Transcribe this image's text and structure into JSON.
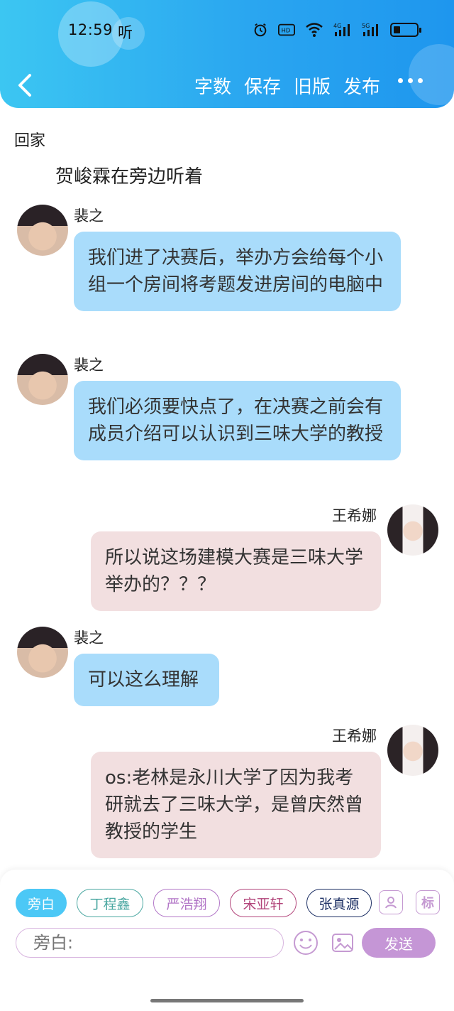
{
  "status_bar": {
    "time": "12:59",
    "extra": "听",
    "icons": [
      "alarm-icon",
      "hd-icon",
      "wifi-icon",
      "signal-4g-icon",
      "signal-5g-icon",
      "battery-icon"
    ]
  },
  "nav": {
    "actions": [
      "字数",
      "保存",
      "旧版",
      "发布"
    ]
  },
  "content": {
    "section_title": "回家",
    "narration": "贺峻霖在旁边听着",
    "messages": [
      {
        "side": "left",
        "sender": "裴之",
        "avatar": "boy-avatar",
        "text": "我们进了决赛后，举办方会给每个小组一个房间将考题发进房间的电脑中"
      },
      {
        "side": "left",
        "sender": "裴之",
        "avatar": "boy-avatar",
        "text": "我们必须要快点了，在决赛之前会有成员介绍可以认识到三味大学的教授"
      },
      {
        "side": "right",
        "sender": "王希娜",
        "avatar": "girl-avatar",
        "text": "所以说这场建模大赛是三味大学举办的？？？"
      },
      {
        "side": "left",
        "sender": "裴之",
        "avatar": "boy-avatar",
        "text": "可以这么理解"
      },
      {
        "side": "right",
        "sender": "王希娜",
        "avatar": "girl-avatar",
        "text": "os:老林是永川大学了因为我考研就去了三味大学，是曾庆然曾教授的学生"
      }
    ]
  },
  "bottom": {
    "roles": [
      {
        "label": "旁白",
        "active": true,
        "color": "#4cc8f6"
      },
      {
        "label": "丁程鑫",
        "active": false,
        "color": "#4aa7a1"
      },
      {
        "label": "严浩翔",
        "active": false,
        "color": "#b276c7"
      },
      {
        "label": "宋亚轩",
        "active": false,
        "color": "#b2447a"
      },
      {
        "label": "张真源",
        "active": false,
        "color": "#1b2e63"
      }
    ],
    "tag_label": "标",
    "input_placeholder": "旁白:",
    "send_label": "发送",
    "colors": {
      "send_bg": "#c596d6",
      "icon": "#c59ad2"
    }
  },
  "colors": {
    "header_gradient": [
      "#3cc6f2",
      "#1e96ee"
    ],
    "bubble_blue": "#a9dcfb",
    "bubble_pink": "#f2dfe0"
  }
}
